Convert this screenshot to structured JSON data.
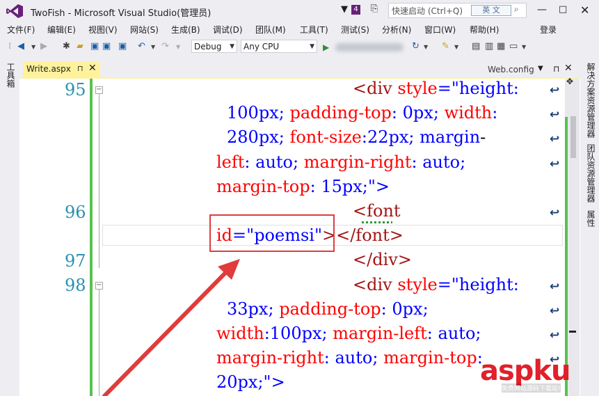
{
  "window": {
    "title": "TwoFish - Microsoft Visual Studio(管理员)",
    "notification_count": "4",
    "quick_launch_placeholder": "快速启动 (Ctrl+Q)",
    "ime_label": "英 文",
    "minimize": "—",
    "maximize": "□",
    "close": "✕"
  },
  "menu": {
    "items": [
      "文件(F)",
      "编辑(E)",
      "视图(V)",
      "网站(S)",
      "生成(B)",
      "调试(D)",
      "团队(M)",
      "工具(T)",
      "测试(S)",
      "分析(N)",
      "窗口(W)",
      "帮助(H)"
    ],
    "login": "登录"
  },
  "toolbar": {
    "configuration": "Debug",
    "platform": "Any CPU"
  },
  "left_panel": {
    "label": "工具箱"
  },
  "right_panels": [
    "解决方案资源管理器",
    "团队资源管理器",
    "属性"
  ],
  "tabs": {
    "active": "Write.aspx",
    "active_pin": "⊓",
    "active_close": "✕",
    "secondary": "Web.config"
  },
  "editor": {
    "line_numbers": [
      "95",
      "96",
      "97",
      "98"
    ],
    "lines": [
      {
        "text": "<div style=\"height:"
      },
      {
        "text": "100px; padding-top: 0px; width:"
      },
      {
        "text": "280px; font-size:22px; margin-"
      },
      {
        "text": "left: auto; margin-right: auto;"
      },
      {
        "text": "margin-top: 15px;\">"
      },
      {
        "text": "<font"
      },
      {
        "text": "id=\"poemsi\"></font>"
      },
      {
        "text": "</div>"
      },
      {
        "text": "<div style=\"height:"
      },
      {
        "text": "33px; padding-top: 0px;"
      },
      {
        "text": "width:100px; margin-left: auto;"
      },
      {
        "text": "margin-right: auto; margin-top:"
      },
      {
        "text": "20px;\">"
      }
    ]
  },
  "watermark": {
    "main": "aspku",
    "sub": "免费网站源码下载站!"
  }
}
